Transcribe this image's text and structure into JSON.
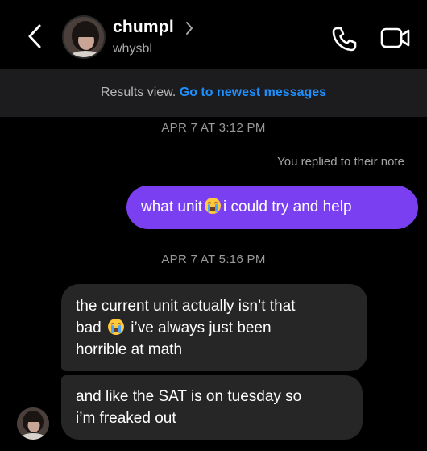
{
  "header": {
    "contact_name": "chumpl",
    "contact_username": "whysbl"
  },
  "banner": {
    "text": "Results view.",
    "link": "Go to newest messages"
  },
  "messages": [
    {
      "timestamp": "APR 7 AT 3:12 PM"
    },
    {
      "reply_note": "You replied to their note"
    },
    {
      "outgoing_part1": "what unit",
      "outgoing_part2": "i could try and help"
    },
    {
      "timestamp": "APR 7 AT 5:16 PM"
    },
    {
      "incoming_line1": "the current unit actually isn’t that",
      "incoming_line2a": "bad",
      "incoming_line2b": "i’ve always just been",
      "incoming_line3": "horrible at math"
    },
    {
      "incoming_line1": "and like the SAT is on tuesday so",
      "incoming_line2": "i’m freaked out"
    }
  ],
  "colors": {
    "accent_link": "#1e90ff",
    "outgoing_bubble": "#7b3ff2",
    "incoming_bubble": "#262626",
    "banner_bg": "#1c1c1e"
  },
  "icons": [
    "back-chevron-icon",
    "chevron-right-icon",
    "phone-icon",
    "video-camera-icon",
    "loudly-crying-emoji"
  ]
}
